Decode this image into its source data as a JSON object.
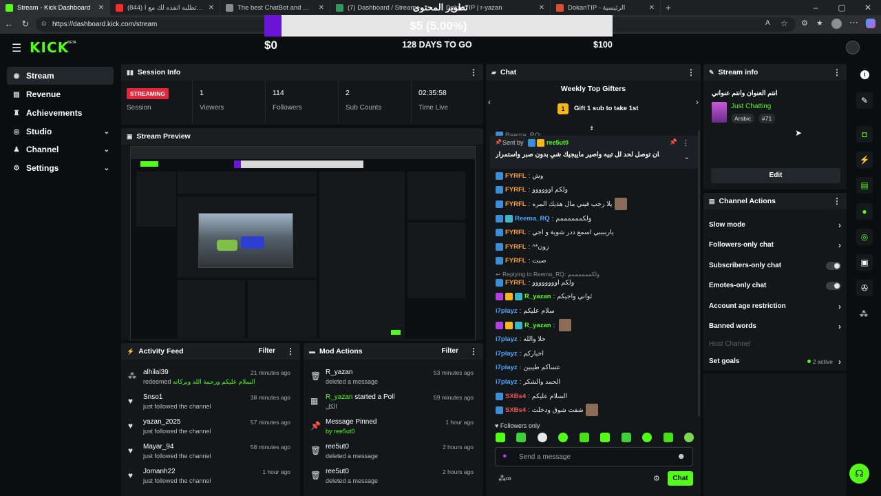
{
  "browser": {
    "tabs": [
      {
        "title": "Stream - Kick Dashboard",
        "color": "#53fc18"
      },
      {
        "title": "(844) اي طلب تطلبه انفذه لك مع ا",
        "color": "#ff2a2a"
      },
      {
        "title": "The best ChatBot and Widgets fo",
        "color": "#8a8a8a"
      },
      {
        "title": "(7) Dashboard / Stream",
        "color": "#2e9a5a"
      },
      {
        "title": "DokanTIP | r-yazan",
        "color": "#e04d2e"
      },
      {
        "title": "DokanTIP - الرئيسية",
        "color": "#e04d2e"
      }
    ],
    "url": "https://dashboard.kick.com/stream"
  },
  "overlay": {
    "title": "تطوير المحتوى",
    "goal_percent_label": "$5 (5.00%)",
    "goal_fraction": 0.05,
    "start_amount": "$0",
    "days_left": "128 DAYS TO GO",
    "target_amount": "$100"
  },
  "sidebar": {
    "items": [
      {
        "label": "Stream",
        "icon": "broadcast-icon"
      },
      {
        "label": "Revenue",
        "icon": "revenue-icon"
      },
      {
        "label": "Achievements",
        "icon": "trophy-icon"
      },
      {
        "label": "Studio",
        "icon": "studio-icon"
      },
      {
        "label": "Channel",
        "icon": "channel-icon"
      },
      {
        "label": "Settings",
        "icon": "gear-icon"
      }
    ]
  },
  "session_info": {
    "title": "Session Info",
    "status_badge": "STREAMING",
    "session_label": "Session",
    "stats": [
      {
        "value": "1",
        "label": "Viewers"
      },
      {
        "value": "114",
        "label": "Followers"
      },
      {
        "value": "2",
        "label": "Sub Counts"
      },
      {
        "value": "02:35:58",
        "label": "Time Live"
      }
    ]
  },
  "stream_preview": {
    "title": "Stream Preview"
  },
  "activity_feed": {
    "title": "Activity Feed",
    "filter": "Filter",
    "items": [
      {
        "name": "alhilal39",
        "desc": "redeemed",
        "extra": "السلام عليكم ورحمة الله وبركاته",
        "time": "21 minutes ago"
      },
      {
        "name": "Snso1",
        "desc": "just followed the channel",
        "extra": "",
        "time": "38 minutes ago"
      },
      {
        "name": "yazan_2025",
        "desc": "just followed the channel",
        "extra": "",
        "time": "57 minutes ago"
      },
      {
        "name": "Mayar_94",
        "desc": "just followed the channel",
        "extra": "",
        "time": "58 minutes ago"
      },
      {
        "name": "Jomanh22",
        "desc": "just followed the channel",
        "extra": "",
        "time": "1 hour ago"
      }
    ]
  },
  "mod_actions": {
    "title": "Mod Actions",
    "filter": "Filter",
    "items": [
      {
        "name": "R_yazan",
        "name2": "",
        "desc": "deleted a message",
        "time": "53 minutes ago"
      },
      {
        "name": "R_yazan",
        "name2": "started a Poll",
        "desc": "الكل",
        "time": "59 minutes ago"
      },
      {
        "name": "Message Pinned",
        "name2": "",
        "desc": "by ree5ut0",
        "time": "1 hour ago"
      },
      {
        "name": "ree5ut0",
        "name2": "",
        "desc": "deleted a message",
        "time": "2 hours ago"
      },
      {
        "name": "ree5ut0",
        "name2": "",
        "desc": "deleted a message",
        "time": "2 hours ago"
      }
    ]
  },
  "chat": {
    "title": "Chat",
    "gifters_title": "Weekly Top Gifters",
    "gift_rank": "1",
    "gift_text": "Gift 1 sub to take 1st",
    "top_partial": "Reema_RQ: ...",
    "pinned": {
      "sent_by": "Sent by",
      "author": "ree5ut0",
      "text": "استمر عشان توصل لحد لل تبيه واصير ماييجيك شي بدون صبر واستمرار"
    },
    "messages": [
      {
        "user": "FYRFL",
        "color": "#f59d3a",
        "text": "وش"
      },
      {
        "user": "FYRFL",
        "color": "#f59d3a",
        "text": "ولكم اوووووو"
      },
      {
        "user": "FYRFL",
        "color": "#f59d3a",
        "text": "يلا رجب فيني مال هذيك المره"
      },
      {
        "user": "Reema_RQ",
        "color": "#4aa6ff",
        "text": "ولكممممممم"
      },
      {
        "user": "FYRFL",
        "color": "#f59d3a",
        "text": "يارببببي اسمع ددر شوية و اجي"
      },
      {
        "user": "FYRFL",
        "color": "#f59d3a",
        "text": "^*زون"
      },
      {
        "user": "FYRFL",
        "color": "#f59d3a",
        "text": "صبت"
      },
      {
        "reply": "Replying to Reema_RQ: ولكممممممم"
      },
      {
        "user": "FYRFL",
        "color": "#f59d3a",
        "text": "ولكم اوووووووو"
      },
      {
        "user": "R_yazan",
        "color": "#53fc18",
        "text": "ثواني واجيكم"
      },
      {
        "user": "i7playz",
        "color": "#4aa6ff",
        "text": "سلام عليكم"
      },
      {
        "user": "R_yazan",
        "color": "#53fc18",
        "text": ""
      },
      {
        "user": "i7playz",
        "color": "#4aa6ff",
        "text": "حلا والله"
      },
      {
        "user": "i7playz",
        "color": "#4aa6ff",
        "text": "اخباركم"
      },
      {
        "user": "i7playz",
        "color": "#4aa6ff",
        "text": "عساكم طيبين"
      },
      {
        "user": "i7playz",
        "color": "#4aa6ff",
        "text": "الحمد والشكر"
      },
      {
        "user": "SXBs4",
        "color": "#f2545b",
        "text": "السلام عليكم"
      },
      {
        "user": "SXBs4",
        "color": "#f2545b",
        "text": "شفت شوق ودخلت"
      }
    ],
    "followers_only": "Followers only",
    "send_placeholder": "Send a message",
    "send_button": "Chat"
  },
  "stream_info": {
    "title": "Stream info",
    "stream_title": "انتم العنوان وانتم عنواني",
    "category": "Just Chatting",
    "tags": [
      "Arabic",
      "#71"
    ],
    "edit_button": "Edit"
  },
  "channel_actions": {
    "title": "Channel Actions",
    "rows": [
      {
        "label": "Slow mode",
        "type": "arrow"
      },
      {
        "label": "Followers-only chat",
        "type": "arrow"
      },
      {
        "label": "Subscribers-only chat",
        "type": "toggle"
      },
      {
        "label": "Emotes-only chat",
        "type": "toggle"
      },
      {
        "label": "Account age restriction",
        "type": "arrow"
      },
      {
        "label": "Banned words",
        "type": "arrow"
      },
      {
        "label": "Host Channel",
        "type": "disabled"
      },
      {
        "label": "Set goals",
        "type": "arrow",
        "status": "2 active"
      }
    ]
  },
  "colors": {
    "brand": "#53fc18",
    "streaming_badge": "#e3263a",
    "goal_fill": "#6a14d8"
  }
}
